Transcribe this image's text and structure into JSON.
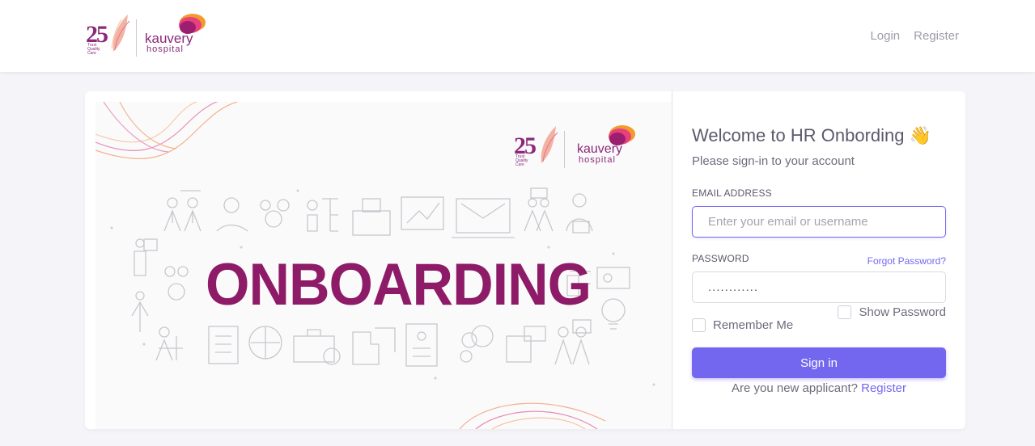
{
  "brand": {
    "anniversary": "25",
    "tagline": "Trust Quality Care",
    "name": "kauvery",
    "sub": "hospital"
  },
  "nav": {
    "login": "Login",
    "register": "Register"
  },
  "illustration": {
    "word": "ONBOARDING"
  },
  "form": {
    "title": "Welcome to HR Onbording",
    "wave": "👋",
    "subtitle": "Please sign-in to your account",
    "email_label": "EMAIL ADDRESS",
    "email_placeholder": "Enter your email or username",
    "password_label": "PASSWORD",
    "forgot": "Forgot Password?",
    "password_value": "............",
    "show_password": "Show Password",
    "remember": "Remember Me",
    "signin": "Sign in",
    "new_applicant": "Are you new applicant?",
    "register": "Register"
  },
  "colors": {
    "accent": "#7367f0",
    "brand": "#8e1b67"
  }
}
